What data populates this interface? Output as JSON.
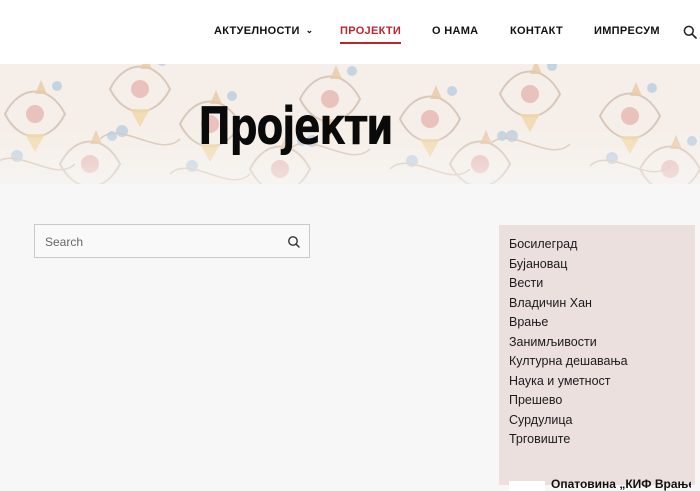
{
  "nav": {
    "items": [
      {
        "label": "АКТУЕЛНОСТИ",
        "active": false,
        "has_dropdown": true
      },
      {
        "label": "ПРОЈЕКТИ",
        "active": true,
        "has_dropdown": false
      },
      {
        "label": "О НАМА",
        "active": false,
        "has_dropdown": false
      },
      {
        "label": "КОНТАКТ",
        "active": false,
        "has_dropdown": false
      },
      {
        "label": "ИМПРЕСУМ",
        "active": false,
        "has_dropdown": false
      }
    ],
    "dropdown_icon": "chevron-down-icon",
    "search_icon": "search-icon",
    "accent_color": "#c0242c"
  },
  "hero": {
    "title": "Пројекти",
    "background": "floral-ornament-pattern"
  },
  "search": {
    "placeholder": "Search",
    "value": "",
    "icon": "search-icon"
  },
  "sidebar": {
    "background_color": "#ece0de",
    "categories": [
      "Босилеград",
      "Бујановац",
      "Вести",
      "Владичин Хан",
      "Врање",
      "Занимљивости",
      "Културна дешавања",
      "Наука и уметност",
      "Прешево",
      "Сурдулица",
      "Трговиште"
    ],
    "recent_post_title": "Опатовина „КИФ Врање“"
  }
}
